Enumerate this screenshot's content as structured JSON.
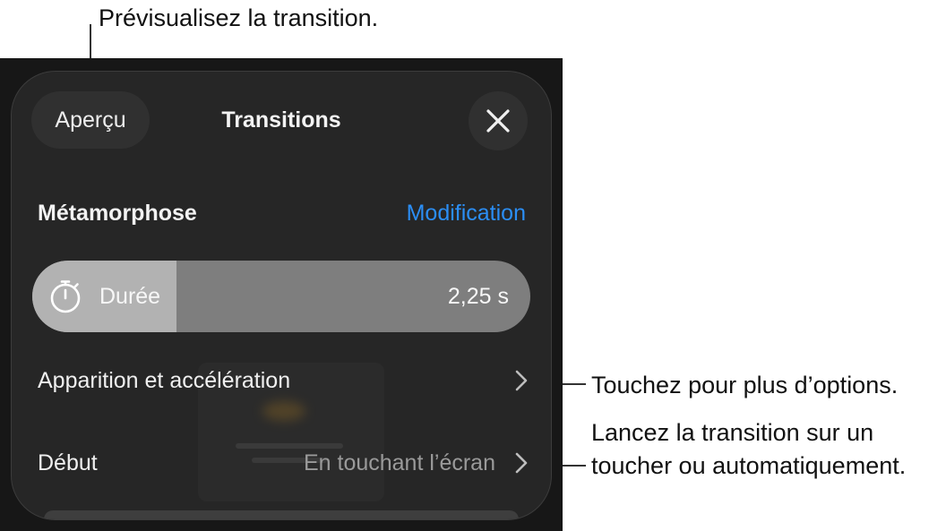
{
  "callouts": {
    "preview": "Prévisualisez la transition.",
    "more_options": "Touchez pour plus d’options.",
    "start_line1": "Lancez la transition sur un",
    "start_line2": "toucher ou automatiquement."
  },
  "header": {
    "preview_button": "Aperçu",
    "title": "Transitions",
    "close_icon": "close-icon"
  },
  "transition": {
    "name": "Métamorphose",
    "edit_link": "Modification"
  },
  "duration": {
    "icon": "timer-icon",
    "label": "Durée",
    "value": "2,25 s",
    "fill_fraction": 0.29
  },
  "rows": {
    "easing": {
      "label": "Apparition et accélération",
      "icon": "chevron-right-icon"
    },
    "start": {
      "label": "Début",
      "value": "En touchant l’écran",
      "icon": "chevron-right-icon"
    }
  },
  "colors": {
    "panel_bg": "#262626",
    "accent": "#2b8ef5",
    "slider_fill": "#b2b2b2",
    "slider_track": "#7e7e7e"
  }
}
